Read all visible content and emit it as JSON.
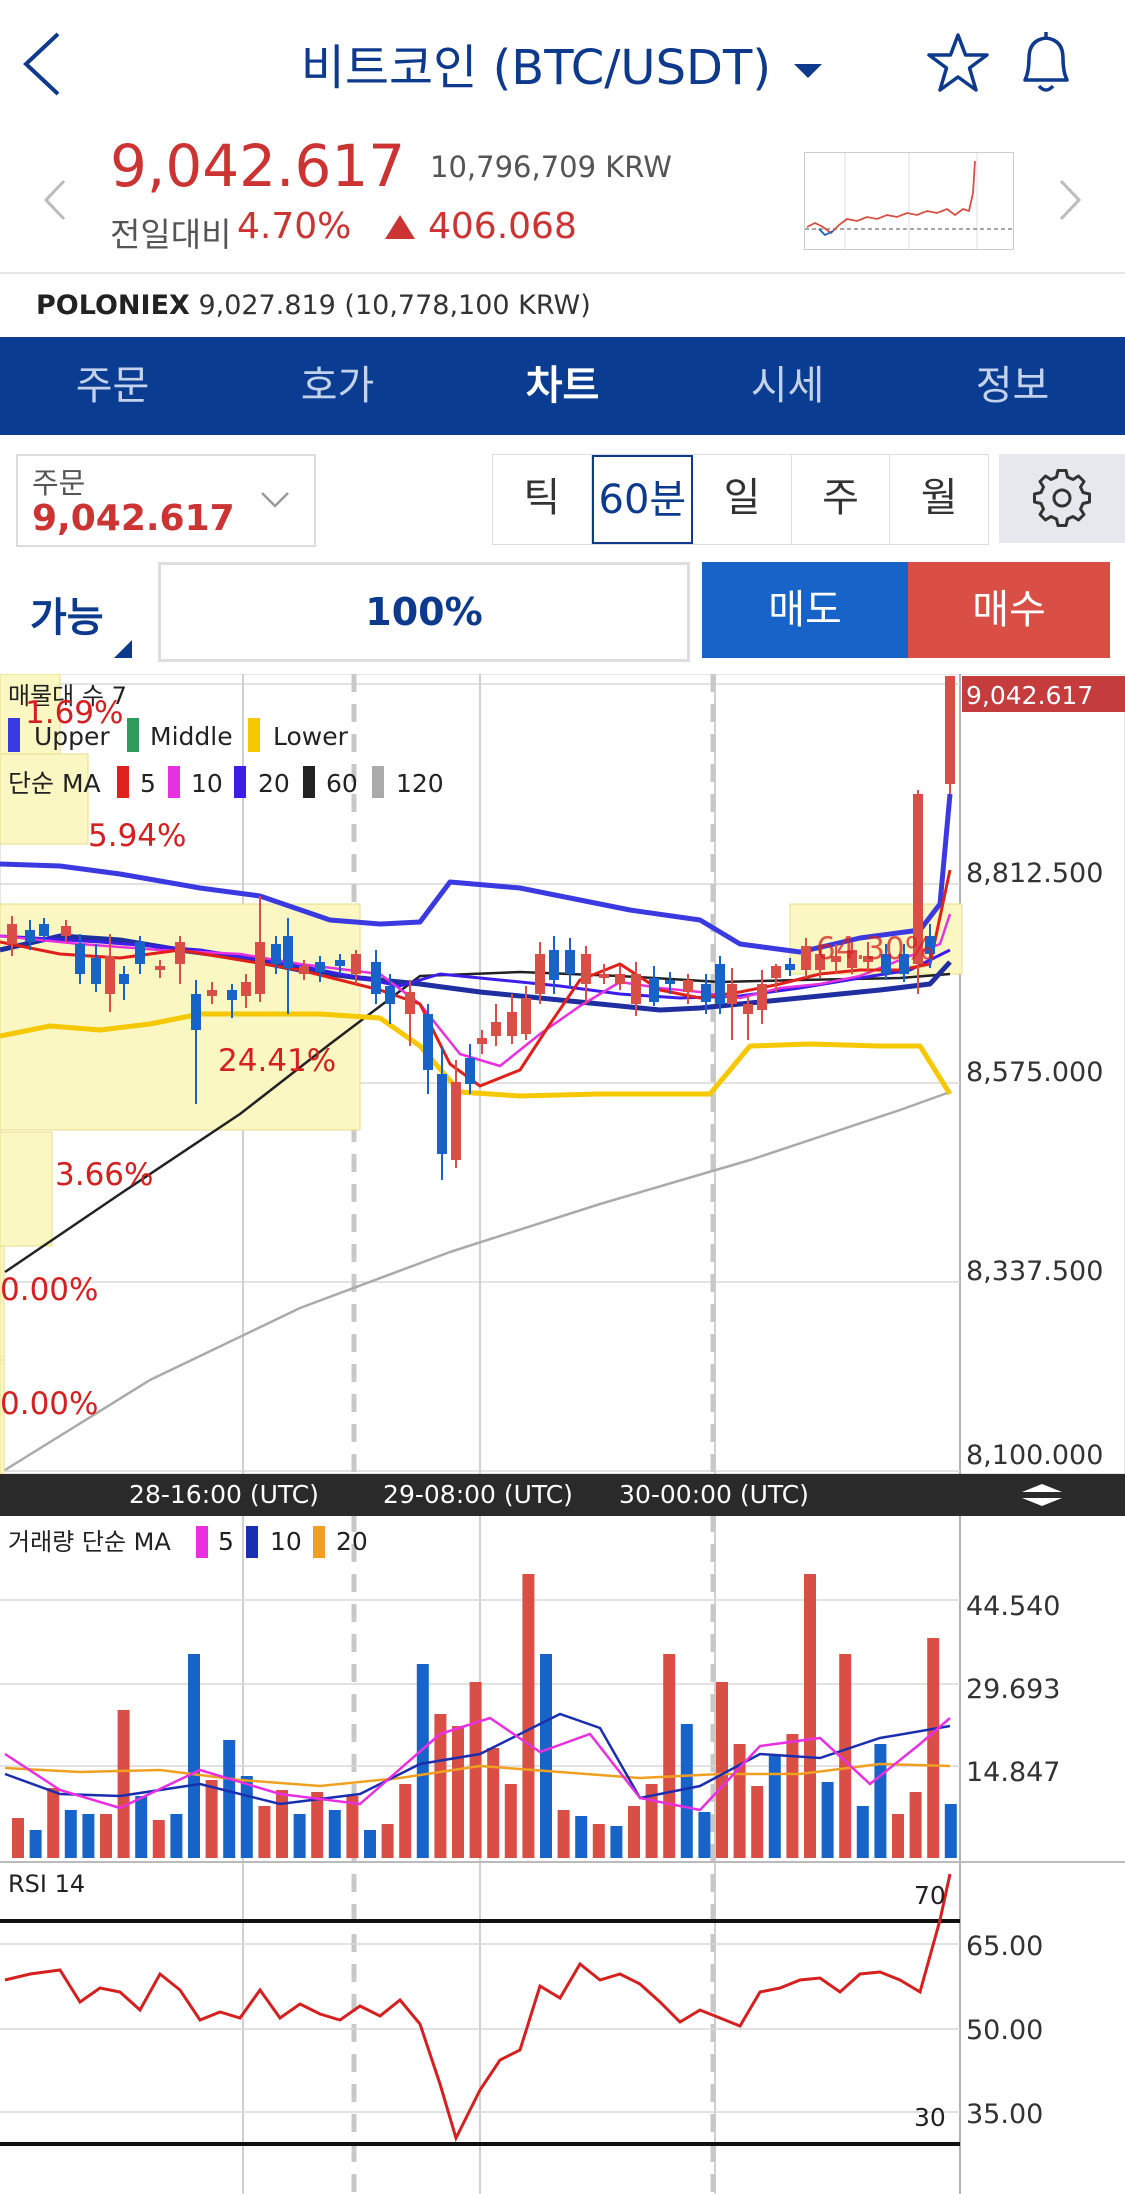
{
  "header": {
    "title": "비트코인 (BTC/USDT)",
    "icons": [
      "back-arrow-icon",
      "dropdown-caret-icon",
      "star-icon",
      "bell-icon"
    ]
  },
  "price": {
    "last": "9,042.617",
    "krw": "10,796,709 KRW",
    "change_label": "전일대비",
    "change_pct": "4.70%",
    "change_abs": "406.068",
    "color_up": "#cc3333"
  },
  "exchange": {
    "name": "POLONIEX",
    "value": "9,027.819 (10,778,100 KRW)"
  },
  "tabs": [
    {
      "label": "주문"
    },
    {
      "label": "호가"
    },
    {
      "label": "차트",
      "active": true
    },
    {
      "label": "시세"
    },
    {
      "label": "정보"
    }
  ],
  "order": {
    "label": "주문",
    "value": "9,042.617"
  },
  "periods": [
    {
      "label": "틱"
    },
    {
      "label": "60분",
      "active": true
    },
    {
      "label": "일"
    },
    {
      "label": "주"
    },
    {
      "label": "월"
    }
  ],
  "trade": {
    "available": "가능",
    "percent": "100%",
    "sell": "매도",
    "buy": "매수"
  },
  "chart_data": {
    "type": "candlestick",
    "main": {
      "header": "매물대 수 7",
      "bb_legend": [
        "Upper",
        "Middle",
        "Lower"
      ],
      "ma_label": "단순 MA",
      "ma_legend": [
        "5",
        "10",
        "20",
        "60",
        "120"
      ],
      "yticks": [
        "8,812.500",
        "8,575.000",
        "8,337.500",
        "8,100.000"
      ],
      "last_price": "9,042.617",
      "volume_profile_labels": [
        "1.69%",
        "5.94%",
        "24.41%",
        "3.66%",
        "0.00%",
        "0.00%",
        "64.30%"
      ],
      "xticks": [
        "28-16:00 (UTC)",
        "29-08:00 (UTC)",
        "30-00:00 (UTC)"
      ]
    },
    "volume": {
      "header": "거래량 단순 MA",
      "ma_legend": [
        "5",
        "10",
        "20"
      ],
      "yticks": [
        "44.540",
        "29.693",
        "14.847"
      ]
    },
    "rsi": {
      "header": "RSI 14",
      "levels": [
        "70",
        "30"
      ],
      "yticks": [
        "65.00",
        "50.00",
        "35.00"
      ]
    },
    "colors": {
      "up": "#d94f45",
      "down": "#1863c7",
      "bb_upper": "#3a3ae0",
      "bb_middle": "#2e9a5e",
      "bb_lower": "#f5c800",
      "ma5": "#e0201a",
      "ma10": "#e830e0",
      "ma20": "#3c1ee8",
      "ma60": "#222222",
      "ma120": "#aaaaaa"
    }
  }
}
